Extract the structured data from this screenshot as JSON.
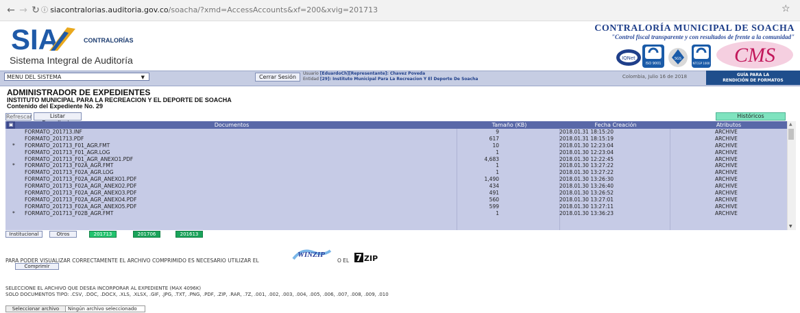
{
  "browser": {
    "url_host": "siacontralorias.auditoria.gov.co",
    "url_path": "/soacha/?xmd=AccessAccounts&xf=200&xvig=201713"
  },
  "header": {
    "logo_text": "SIA",
    "logo_sub": "CONTRALORÍAS",
    "system_name": "Sistema Integral de Auditoría",
    "org_title": "CONTRALORÍA MUNICIPAL DE SOACHA",
    "org_slogan": "\"Control fiscal transparente y con resultados de frente a la comunidad\"",
    "cms_logo_text": "CMS",
    "badges": [
      "IQNet",
      "ISO 9001",
      "SGS",
      "NTCGP 1000"
    ]
  },
  "menubar": {
    "menu_select": "MENU DEL SISTEMA",
    "logout": "Cerrar Sesión",
    "user_label": "Usuario",
    "user_value": "[EduardoCh][Representante]: Chavez Poveda",
    "entity_label": "Entidad",
    "entity_value": "[29]: Instituto Municipal Para La Recreacion Y El Deporte De Soacha",
    "date": "Colombia, Julio 16 de 2018",
    "guide": [
      "GUÍA PARA LA",
      "RENDICIÓN DE FORMATOS"
    ]
  },
  "titles": {
    "main": "ADMINISTRADOR DE EXPEDIENTES",
    "institution": "INSTITUTO MUNICIPAL PARA LA RECREACION Y EL DEPORTE DE SOACHA",
    "subtitle": "Contenido del Expediente No. 29"
  },
  "toolbar": {
    "refresh": "Refrescar",
    "list": "Listar Expediente",
    "history": "Históricos"
  },
  "table": {
    "headers": {
      "documents": "Documentos",
      "size": "Tamaño (KB)",
      "date": "Fecha Creación",
      "attributes": "Atributos"
    },
    "rows": [
      {
        "mark": "",
        "doc": "FORMATO_201713.INF",
        "size": "9",
        "date": "2018.01.31 18:15:20",
        "attr": "ARCHIVE"
      },
      {
        "mark": "",
        "doc": "FORMATO_201713.PDF",
        "size": "617",
        "date": "2018.01.31 18:15:19",
        "attr": "ARCHIVE"
      },
      {
        "mark": "*",
        "doc": "FORMATO_201713_F01_AGR.FMT",
        "size": "10",
        "date": "2018.01.30 12:23:04",
        "attr": "ARCHIVE"
      },
      {
        "mark": "",
        "doc": "FORMATO_201713_F01_AGR.LOG",
        "size": "1",
        "date": "2018.01.30 12:23:04",
        "attr": "ARCHIVE"
      },
      {
        "mark": "",
        "doc": "FORMATO_201713_F01_AGR_ANEXO1.PDF",
        "size": "4,683",
        "date": "2018.01.30 12:22:45",
        "attr": "ARCHIVE"
      },
      {
        "mark": "*",
        "doc": "FORMATO_201713_F02A_AGR.FMT",
        "size": "1",
        "date": "2018.01.30 13:27:22",
        "attr": "ARCHIVE"
      },
      {
        "mark": "",
        "doc": "FORMATO_201713_F02A_AGR.LOG",
        "size": "1",
        "date": "2018.01.30 13:27:22",
        "attr": "ARCHIVE"
      },
      {
        "mark": "",
        "doc": "FORMATO_201713_F02A_AGR_ANEXO1.PDF",
        "size": "1,490",
        "date": "2018.01.30 13:26:30",
        "attr": "ARCHIVE"
      },
      {
        "mark": "",
        "doc": "FORMATO_201713_F02A_AGR_ANEXO2.PDF",
        "size": "434",
        "date": "2018.01.30 13:26:40",
        "attr": "ARCHIVE"
      },
      {
        "mark": "",
        "doc": "FORMATO_201713_F02A_AGR_ANEXO3.PDF",
        "size": "491",
        "date": "2018.01.30 13:26:52",
        "attr": "ARCHIVE"
      },
      {
        "mark": "",
        "doc": "FORMATO_201713_F02A_AGR_ANEXO4.PDF",
        "size": "560",
        "date": "2018.01.30 13:27:01",
        "attr": "ARCHIVE"
      },
      {
        "mark": "",
        "doc": "FORMATO_201713_F02A_AGR_ANEXO5.PDF",
        "size": "599",
        "date": "2018.01.30 13:27:11",
        "attr": "ARCHIVE"
      },
      {
        "mark": "*",
        "doc": "FORMATO_201713_F02B_AGR.FMT",
        "size": "1",
        "date": "2018.01.30 13:36:23",
        "attr": "ARCHIVE"
      }
    ]
  },
  "tabs": {
    "institutional": "Institucional",
    "others": "Otros",
    "years": [
      "201713",
      "201706",
      "201613"
    ]
  },
  "compress": {
    "notice": "PARA PODER VISUALIZAR CORRECTAMENTE EL ARCHIVO COMPRIMIDO ES NECESARIO UTILIZAR EL",
    "or": "O EL",
    "winzip_label": "WINZIP",
    "zip7_label": "ZIP",
    "button": "Comprimir"
  },
  "upload": {
    "instruction1": "SELECCIONE EL ARCHIVO QUE DESEA INCORPORAR AL EXPEDIENTE (MAX 4096K)",
    "instruction2": "SOLO DOCUMENTOS TIPO: .CSV, .DOC, .DOCX, .XLS, .XLSX, .GIF, .JPG, .TXT, .PNG, .PDF, .ZIP, .RAR, .7Z, .001, .002, .003, .004, .005, .006, .007, .008, .009, .010",
    "select_button": "Seleccionar archivo",
    "no_file": "Ningún archivo seleccionado"
  }
}
